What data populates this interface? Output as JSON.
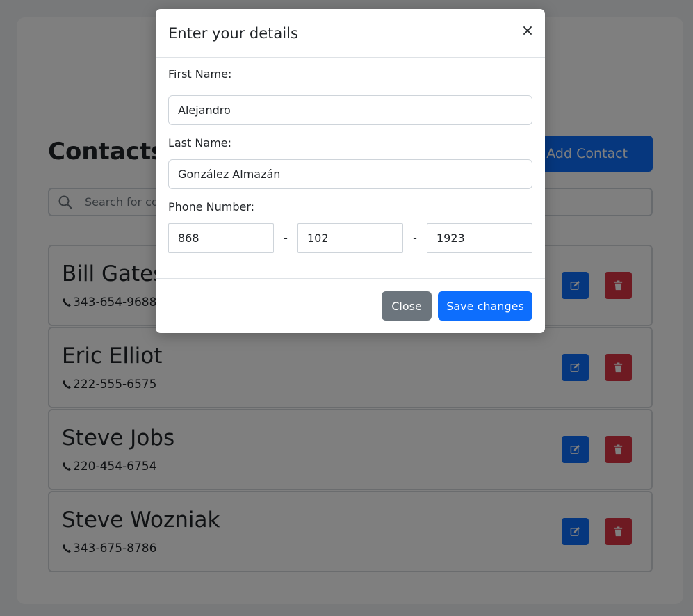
{
  "page": {
    "title": "Contacts",
    "add_button_label": "Add Contact",
    "search_placeholder": "Search for contacts..."
  },
  "contacts": [
    {
      "name": "Bill Gates",
      "phone": "343-654-9688"
    },
    {
      "name": "Eric Elliot",
      "phone": "222-555-6575"
    },
    {
      "name": "Steve Jobs",
      "phone": "220-454-6754"
    },
    {
      "name": "Steve Wozniak",
      "phone": "343-675-8786"
    }
  ],
  "modal": {
    "title": "Enter your details",
    "close_glyph": "×",
    "first_name_label": "First Name:",
    "first_name_value": "Alejandro",
    "last_name_label": "Last Name:",
    "last_name_value": "González Almazán",
    "phone_label": "Phone Number:",
    "phone_part1": "868",
    "phone_part2": "102",
    "phone_part3": "1923",
    "dash": "-",
    "close_button_label": "Close",
    "save_button_label": "Save changes"
  },
  "colors": {
    "primary": "#0d6efd",
    "danger": "#dc3545",
    "secondary": "#6c757d"
  },
  "icons": {
    "add": "plus-icon",
    "search": "search-icon",
    "phone": "phone-icon",
    "edit": "edit-icon",
    "delete": "trash-icon",
    "close": "close-icon"
  }
}
